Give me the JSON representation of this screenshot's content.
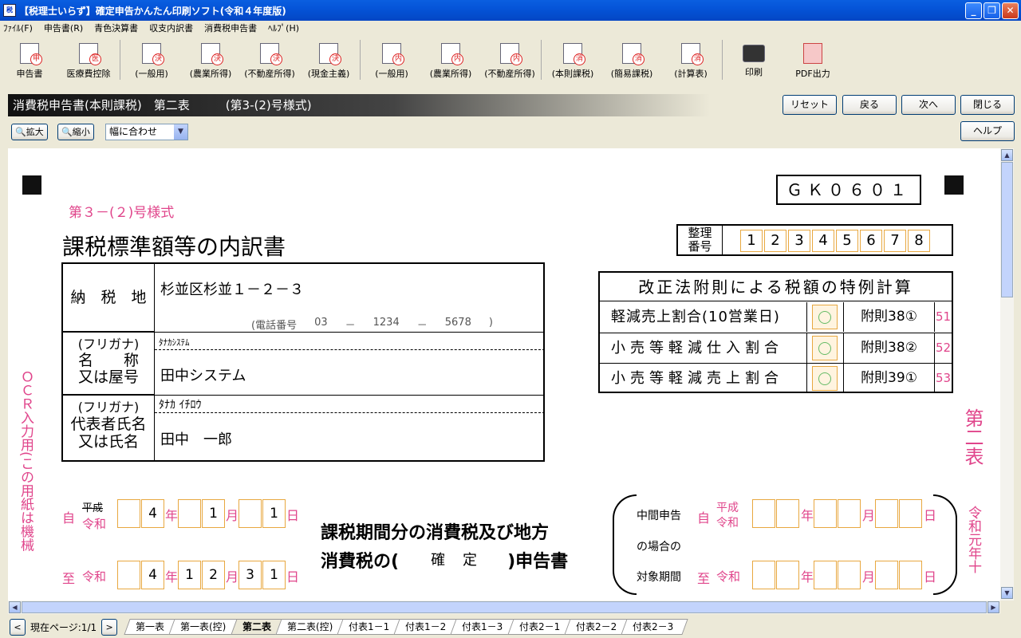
{
  "window": {
    "title": "【税理士いらず】確定申告かんたん印刷ソフト(令和４年度版)",
    "min": "_",
    "max": "❐",
    "close": "✕"
  },
  "menu": [
    "ﾌｧｲﾙ(F)",
    "申告書(R)",
    "青色決算書",
    "収支内訳書",
    "消費税申告書",
    "ﾍﾙﾌﾟ(H)"
  ],
  "toolbar": [
    {
      "label": "申告書",
      "mark": "申",
      "icon": "form-icon"
    },
    {
      "label": "医療費控除",
      "mark": "医",
      "icon": "form-icon"
    },
    {
      "label": "(一般用)",
      "mark": "決",
      "icon": "form-icon"
    },
    {
      "label": "(農業所得)",
      "mark": "決",
      "icon": "form-icon"
    },
    {
      "label": "(不動産所得)",
      "mark": "決",
      "icon": "form-icon"
    },
    {
      "label": "(現金主義)",
      "mark": "決",
      "icon": "form-icon"
    },
    {
      "label": "(一般用)",
      "mark": "内",
      "icon": "form-icon"
    },
    {
      "label": "(農業所得)",
      "mark": "内",
      "icon": "form-icon"
    },
    {
      "label": "(不動産所得)",
      "mark": "内",
      "icon": "form-icon"
    },
    {
      "label": "(本則課税)",
      "mark": "消",
      "icon": "form-icon"
    },
    {
      "label": "(簡易課税)",
      "mark": "消",
      "icon": "form-icon"
    },
    {
      "label": "(計算表)",
      "mark": "消",
      "icon": "form-icon"
    },
    {
      "label": "印刷",
      "mark": "",
      "icon": "printer-icon"
    },
    {
      "label": "PDF出力",
      "mark": "",
      "icon": "pdf-icon"
    }
  ],
  "header": {
    "title": "消費税申告書(本則課税)　第二表　　　(第3-(2)号様式)"
  },
  "nav": {
    "reset": "リセット",
    "back": "戻る",
    "next": "次へ",
    "close": "閉じる",
    "help": "ヘルプ"
  },
  "zoom": {
    "in": "拡大",
    "out": "縮小",
    "fit": "幅に合わせ"
  },
  "doc": {
    "code": "ＧＫ０６０１",
    "form_no": "第３－(２)号様式",
    "title": "課税標準額等の内訳書",
    "seiri_label": "整理\n番号",
    "seiri_digits": [
      "1",
      "2",
      "3",
      "4",
      "5",
      "6",
      "7",
      "8"
    ],
    "nouzei_label": "納　税　地",
    "address": "杉並区杉並１－２－３",
    "tel_label": "(電話番号",
    "tel": [
      "03",
      "－",
      "1234",
      "－",
      "5678",
      ")"
    ],
    "furigana_label": "(フリガナ)",
    "name_label": "名　　称\n又は屋号",
    "name_furigana": "ﾀﾅｶｼｽﾃﾑ",
    "name": "田中システム",
    "rep_label": "代表者氏名\n又は氏名",
    "rep_furigana": "ﾀﾅｶ ｲﾁﾛｳ",
    "rep": "田中　一郎",
    "special_title": "改正法附則による税額の特例計算",
    "special_rows": [
      {
        "label": "軽減売上割合(10営業日)",
        "rule": "附則38①",
        "no": "51"
      },
      {
        "label": "小売等軽減仕入割合",
        "rule": "附則38②",
        "no": "52"
      },
      {
        "label": "小売等軽減売上割合",
        "rule": "附則39①",
        "no": "53"
      }
    ],
    "side_vertical": "ＯＣＲ入力用(この用紙は機械",
    "right_vertical": "第二表",
    "right_vertical2": "令和元年十",
    "from_label": "自",
    "to_label": "至",
    "heisei": "平成",
    "reiwa": "令和",
    "period_from": {
      "era": "4",
      "month": "1",
      "day": "1"
    },
    "period_to": {
      "era": "4",
      "month": "12",
      "day": "31"
    },
    "nen": "年",
    "gatsu": "月",
    "nichi": "日",
    "period_title1": "課税期間分の消費税及び地方",
    "period_title2a": "消費税の(",
    "period_kind": "確　定",
    "period_title2b": ")申告書",
    "chukan1": "中間申告",
    "chukan2": "の場合の",
    "chukan3": "対象期間"
  },
  "pager": {
    "label": "現在ページ:1/1",
    "prev": "<",
    "next": ">"
  },
  "tabs": [
    "第一表",
    "第一表(控)",
    "第二表",
    "第二表(控)",
    "付表1－1",
    "付表1－2",
    "付表1－3",
    "付表2－1",
    "付表2－2",
    "付表2－3"
  ],
  "active_tab": 2
}
